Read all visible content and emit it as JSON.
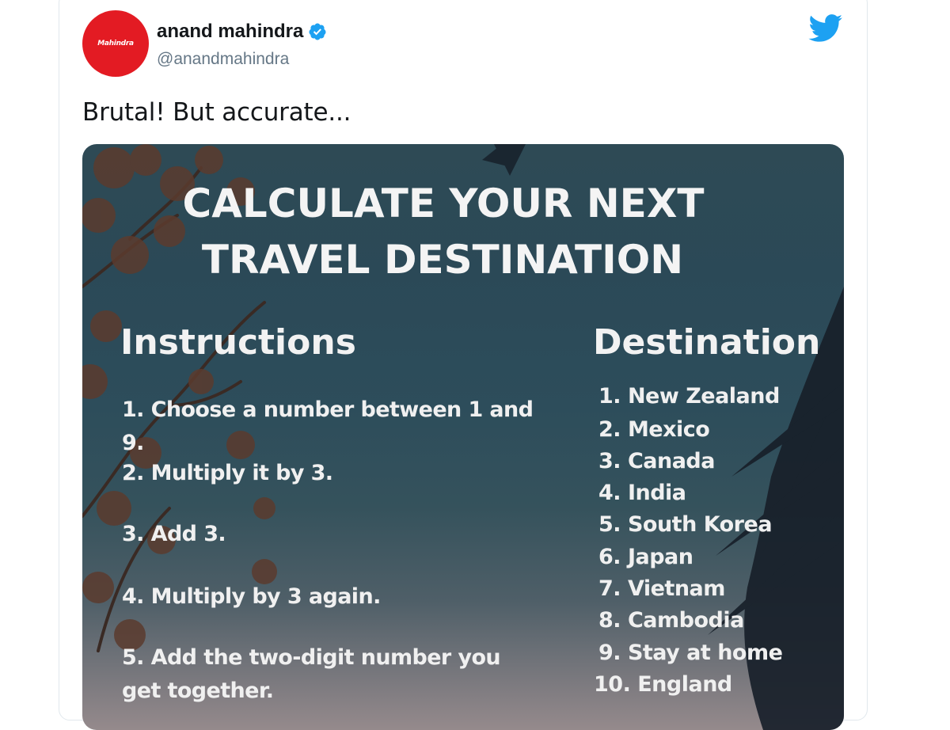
{
  "tweet": {
    "author": {
      "display_name": "anand mahindra",
      "handle": "@anandmahindra",
      "avatar_text": "Mahindra",
      "verified": true
    },
    "text": "Brutal! But accurate...",
    "icons": {
      "brand": "twitter-bird-icon",
      "verified": "verified-badge-icon"
    }
  },
  "poster": {
    "title_line1": "CALCULATE YOUR NEXT",
    "title_line2": "TRAVEL DESTINATION",
    "instructions_heading": "Instructions",
    "destination_heading": "Destination",
    "instructions": [
      "1. Choose a number between 1 and 9.",
      "2. Multiply it by 3.",
      "3. Add 3.",
      "4. Multiply by 3 again.",
      "5. Add the two-digit number you get together."
    ],
    "destinations": [
      "1. New Zealand",
      "2. Mexico",
      "3. Canada",
      "4. India",
      "5. South Korea",
      "6. Japan",
      "7. Vietnam",
      "8. Cambodia",
      "9. Stay at home",
      "10. England"
    ]
  },
  "colors": {
    "brand_red": "#e31b23",
    "twitter_blue": "#1da1f2"
  }
}
